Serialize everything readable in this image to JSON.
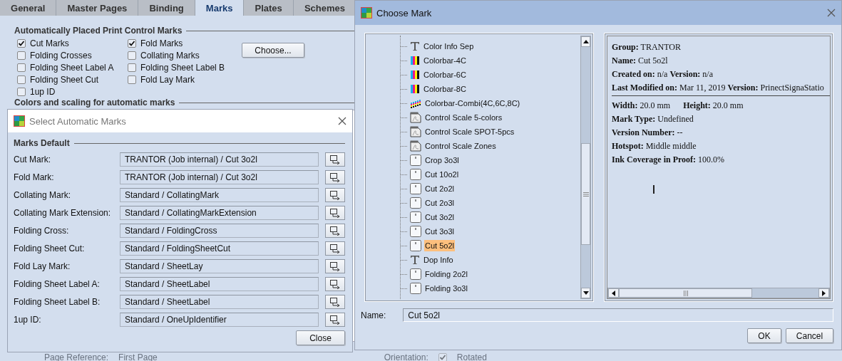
{
  "main_window": {
    "tabs": [
      {
        "label": "General",
        "selected": false
      },
      {
        "label": "Master Pages",
        "selected": false
      },
      {
        "label": "Binding",
        "selected": false
      },
      {
        "label": "Marks",
        "selected": true
      },
      {
        "label": "Plates",
        "selected": false
      },
      {
        "label": "Schemes",
        "selected": false
      }
    ],
    "auto_marks": {
      "title": "Automatically Placed Print Control Marks",
      "checkboxes": [
        {
          "label": "Cut Marks",
          "checked": true
        },
        {
          "label": "Fold Marks",
          "checked": true
        },
        {
          "label": "Folding Crosses",
          "checked": false
        },
        {
          "label": "Collating Marks",
          "checked": false
        },
        {
          "label": "Folding Sheet Label A",
          "checked": false
        },
        {
          "label": "Folding Sheet Label B",
          "checked": false
        },
        {
          "label": "Folding Sheet Cut",
          "checked": false
        },
        {
          "label": "Fold Lay Mark",
          "checked": false
        },
        {
          "label": "1up ID",
          "checked": false
        }
      ],
      "choose_button": "Choose..."
    },
    "colors_section": {
      "title": "Colors and scaling for automatic marks"
    },
    "footer": {
      "page_reference_label": "Page Reference:",
      "page_reference_value": "First Page",
      "orientation_label": "Orientation:",
      "rotated": {
        "label": "Rotated",
        "checked": true
      }
    }
  },
  "select_dialog": {
    "title": "Select Automatic Marks",
    "group_title": "Marks Default",
    "rows": [
      {
        "label": "Cut Mark:",
        "value": "TRANTOR (Job internal) / Cut 3o2l"
      },
      {
        "label": "Fold Mark:",
        "value": "TRANTOR (Job internal) / Cut 3o2l"
      },
      {
        "label": "Collating Mark:",
        "value": "Standard / CollatingMark"
      },
      {
        "label": "Collating Mark Extension:",
        "value": "Standard / CollatingMarkExtension"
      },
      {
        "label": "Folding Cross:",
        "value": "Standard / FoldingCross"
      },
      {
        "label": "Folding Sheet Cut:",
        "value": "Standard / FoldingSheetCut"
      },
      {
        "label": "Fold Lay Mark:",
        "value": "Standard / SheetLay"
      },
      {
        "label": "Folding Sheet Label A:",
        "value": "Standard / SheetLabel"
      },
      {
        "label": "Folding Sheet Label B:",
        "value": "Standard / SheetLabel"
      },
      {
        "label": "1up ID:",
        "value": "Standard / OneUpIdentifier"
      }
    ],
    "close_button": "Close"
  },
  "choose_dialog": {
    "title": "Choose Mark",
    "tree_items": [
      {
        "label": "Color Info Sep",
        "kind": "text",
        "selected": false
      },
      {
        "label": "Colorbar-4C",
        "kind": "colorbar",
        "selected": false
      },
      {
        "label": "Colorbar-6C",
        "kind": "colorbar",
        "selected": false
      },
      {
        "label": "Colorbar-8C",
        "kind": "colorbar",
        "selected": false
      },
      {
        "label": "Colorbar-Combi(4C,6C,8C)",
        "kind": "combi",
        "selected": false
      },
      {
        "label": "Control Scale 5-colors",
        "kind": "pdf",
        "selected": false
      },
      {
        "label": "Control Scale SPOT-5pcs",
        "kind": "pdf",
        "selected": false
      },
      {
        "label": "Control Scale Zones",
        "kind": "pdf",
        "selected": false
      },
      {
        "label": "Crop 3o3l",
        "kind": "mark",
        "selected": false
      },
      {
        "label": "Cut 10o2l",
        "kind": "mark",
        "selected": false
      },
      {
        "label": "Cut 2o2l",
        "kind": "mark",
        "selected": false
      },
      {
        "label": "Cut 2o3l",
        "kind": "mark",
        "selected": false
      },
      {
        "label": "Cut 3o2l",
        "kind": "mark",
        "selected": false
      },
      {
        "label": "Cut 3o3l",
        "kind": "mark",
        "selected": false
      },
      {
        "label": "Cut 5o2l",
        "kind": "mark",
        "selected": true
      },
      {
        "label": "Dop Info",
        "kind": "text",
        "selected": false
      },
      {
        "label": "Folding 2o2l",
        "kind": "mark",
        "selected": false
      },
      {
        "label": "Folding 3o3l",
        "kind": "mark",
        "selected": false
      }
    ],
    "info_lines": [
      {
        "text": "**Group:** TRANTOR",
        "rule_after": false
      },
      {
        "text": "**Name:** Cut 5o2l",
        "rule_after": false
      },
      {
        "text": "**Created on:** n/a **Version:** n/a",
        "rule_after": false
      },
      {
        "text": "**Last Modified on:** Mar 11, 2019 **Version:** PrinectSignaStatio",
        "rule_after": true
      },
      {
        "text": "**Width:** 20.0 mm      **Height:** 20.0 mm",
        "rule_after": false
      },
      {
        "text": "**Mark Type:** Undefined",
        "rule_after": false
      },
      {
        "text": "**Version Number:** --",
        "rule_after": false
      },
      {
        "text": "**Hotspot:** Middle middle",
        "rule_after": false
      },
      {
        "text": "**Ink Coverage in Proof:** 100.0%",
        "rule_after": false
      }
    ],
    "name_label": "Name:",
    "name_value": "Cut 5o2l",
    "buttons": [
      "OK",
      "Cancel"
    ]
  }
}
